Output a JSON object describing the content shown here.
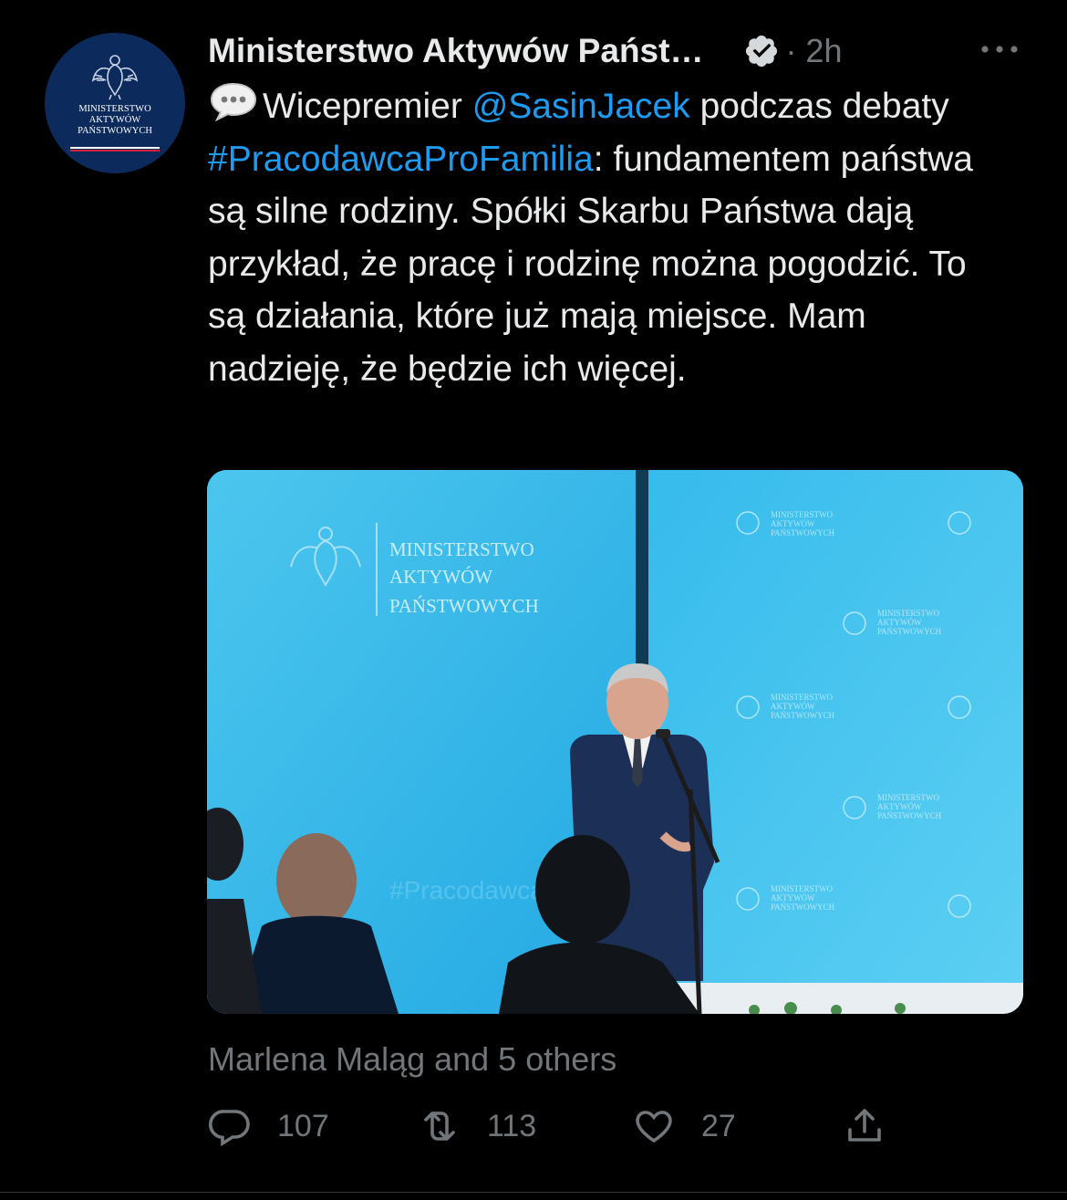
{
  "tweet": {
    "author_name": "Ministerstwo Aktywów Państ…",
    "verified_icon": "verified-badge-icon",
    "timestamp": "· 2h",
    "avatar_text": [
      "MINISTERSTWO",
      "AKTYWÓW",
      "PAŃSTWOWYCH"
    ],
    "text_parts": {
      "p1": "Wicepremier ",
      "mention": "@SasinJacek",
      "p2": " podczas debaty ",
      "hashtag": "#PracodawcaProFamilia",
      "p3": ": fundamentem państwa są silne rodziny. Spółki Skarbu Państwa dają przykład, że pracę i rodzinę można pogodzić. To są działania, które już mają miejsce. Mam nadzieję, że będzie ich więcej."
    },
    "media": {
      "wall_text": [
        "MINISTERSTWO",
        "AKTYWÓW",
        "PAŃSTWOWYCH"
      ],
      "hashtag_faint": "#PracodawcaPro"
    },
    "social_context": "Marlena Maląg and 5 others",
    "actions": {
      "reply_count": "107",
      "retweet_count": "113",
      "like_count": "27"
    }
  },
  "colors": {
    "background": "#000000",
    "text": "#e7e9ea",
    "secondary": "#71767b",
    "link": "#1d9bf0"
  }
}
